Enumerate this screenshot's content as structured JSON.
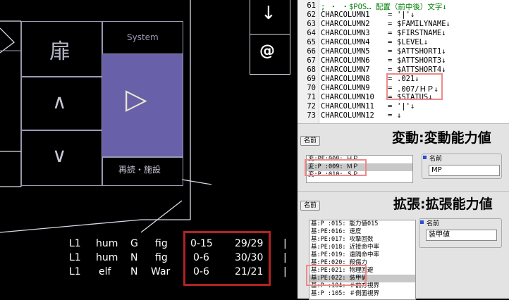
{
  "game": {
    "tile_glyph": "扉",
    "system_label": "System",
    "up_glyph": "∧",
    "down_glyph": "∨",
    "right_glyph": "▷",
    "reload_label": "再読・施設",
    "down_arrow_glyph": "↓",
    "at_glyph": "@",
    "party": [
      {
        "level": "L1",
        "race": "hum",
        "align": "G",
        "class": "fig",
        "range": "0-15",
        "hp": "29/29",
        "bar": "|"
      },
      {
        "level": "L1",
        "race": "hum",
        "align": "N",
        "class": "fig",
        "range": "0-6",
        "hp": "30/30",
        "bar": "|"
      },
      {
        "level": "L1",
        "race": "elf",
        "align": "N",
        "class": "War",
        "range": "0-6",
        "hp": "21/21",
        "bar": "|"
      }
    ],
    "highlight_color": "#b22222"
  },
  "editor": {
    "header_comment": "; ・ ・$POS… 配置（前中後）文字↓",
    "lines": [
      {
        "num": "61",
        "name": "",
        "eq": "",
        "value": ""
      },
      {
        "num": "62",
        "name": "CHARCOLUMN1",
        "eq": "=",
        "value": "'|'↓"
      },
      {
        "num": "63",
        "name": "CHARCOLUMN2",
        "eq": "=",
        "value": "$FAMILYNAME↓"
      },
      {
        "num": "64",
        "name": "CHARCOLUMN3",
        "eq": "=",
        "value": "$FIRSTNAME↓"
      },
      {
        "num": "65",
        "name": "CHARCOLUMN4",
        "eq": "=",
        "value": "$LEVEL↓"
      },
      {
        "num": "66",
        "name": "CHARCOLUMN5",
        "eq": "=",
        "value": "$ATTSHORT1↓"
      },
      {
        "num": "67",
        "name": "CHARCOLUMN6",
        "eq": "=",
        "value": "$ATTSHORT3↓"
      },
      {
        "num": "68",
        "name": "CHARCOLUMN7",
        "eq": "=",
        "value": "$ATTSHORT4↓"
      },
      {
        "num": "69",
        "name": "CHARCOLUMN8",
        "eq": "=",
        "value": ".021↓"
      },
      {
        "num": "70",
        "name": "CHARCOLUMN9",
        "eq": "=",
        "value": ".007/ＨＰ↓"
      },
      {
        "num": "71",
        "name": "CHARCOLUMN10",
        "eq": "=",
        "value": "$STATUS↓"
      },
      {
        "num": "72",
        "name": "CHARCOLUMN11",
        "eq": "=",
        "value": "'|'↓"
      },
      {
        "num": "73",
        "name": "CHARCOLUMN12",
        "eq": "=",
        "value": "↓"
      }
    ],
    "highlight_color": "#ee8a8a"
  },
  "panel1": {
    "name_button": "名前",
    "title": "変動:変動能力値",
    "items": [
      "変:PE:008: ＨＰ",
      "変:P :009: ＭＰ",
      "変:P :010: ＳＰ"
    ],
    "selected_index": 1,
    "group_label": "名前",
    "name_value": "MP"
  },
  "panel2": {
    "name_button": "名前",
    "title": "拡張:拡張能力値",
    "items": [
      "基:P :015: 能力値015",
      "基:PE:016: 速度",
      "基:PE:017: 攻撃回数",
      "基:PE:018: 近接命中率",
      "基:PE:019: 遠隔命中率",
      "基:PE:020: 殺傷力",
      "基:PE:021: 物理回避",
      "基:PE:022: 装甲値",
      "基:P :104: ＃前方視界",
      "基:P :105: ＃側面視界"
    ],
    "selected_index": 7,
    "group_label": "名前",
    "name_value": "装甲値"
  }
}
